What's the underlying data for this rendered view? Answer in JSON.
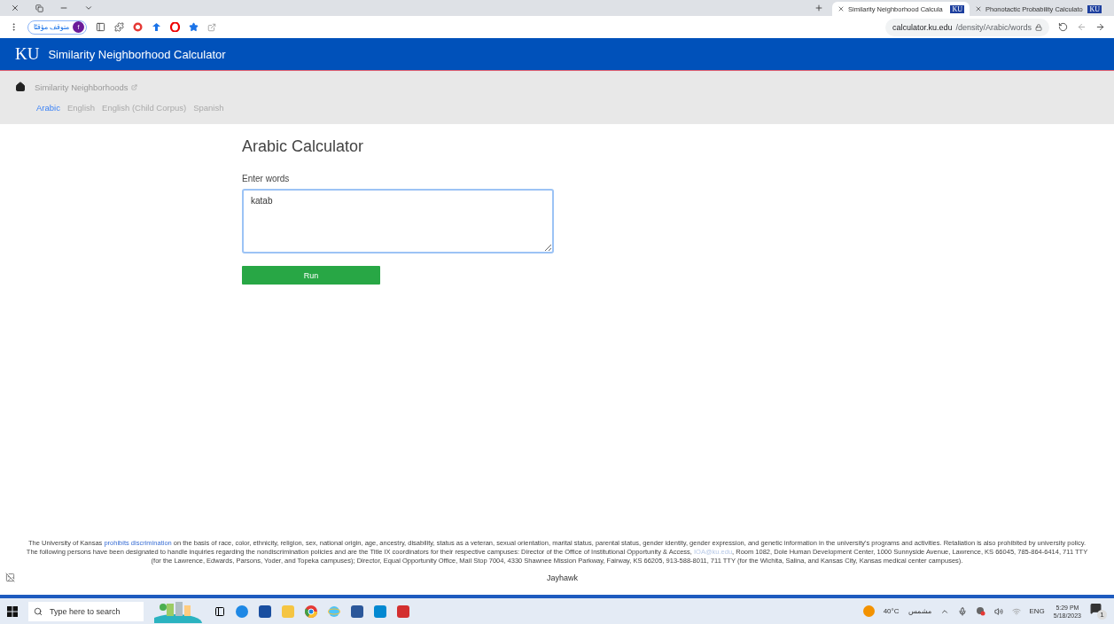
{
  "browser": {
    "tabs": [
      {
        "title": "Similarity Neighborhood Calcula",
        "favicon": "KU",
        "selected": true
      },
      {
        "title": "Phonotactic Probability Calculato",
        "favicon": "KU",
        "selected": false
      }
    ],
    "profile": {
      "initial": "f",
      "label": "متوقف مؤقتًا"
    },
    "address": {
      "host": "calculator.ku.edu",
      "path": "/density/Arabic/words"
    }
  },
  "site": {
    "logo": "KU",
    "title": "Similarity Neighborhood Calculator"
  },
  "breadcrumb": {
    "label": "Similarity Neighborhoods"
  },
  "languages": [
    {
      "label": "Arabic",
      "selected": true
    },
    {
      "label": "English",
      "selected": false
    },
    {
      "label": "English (Child Corpus)",
      "selected": false
    },
    {
      "label": "Spanish",
      "selected": false
    }
  ],
  "calculator": {
    "heading": "Arabic Calculator",
    "field_label": "Enter words",
    "value": "katab",
    "button": "Run"
  },
  "footer": {
    "before": "The University of Kansas ",
    "link": "prohibits discrimination",
    "middle": " on the basis of race, color, ethnicity, religion, sex, national origin, age, ancestry, disability, status as a veteran, sexual orientation, marital status, parental status, gender identity, gender expression, and genetic information in the university's programs and activities. Retaliation is also prohibited by university policy. The following persons have been designated to handle inquiries regarding the nondiscrimination policies and are the Title IX coordinators for their respective campuses: Director of the Office of Institutional Opportunity & Access, ",
    "email": "IOA@ku.edu",
    "after": ", Room 1082, Dole Human Development Center, 1000 Sunnyside Avenue, Lawrence, KS 66045, 785-864-6414, 711 TTY (for the Lawrence, Edwards, Parsons, Yoder, and Topeka campuses); Director, Equal Opportunity Office, Mail Stop 7004, 4330 Shawnee Mission Parkway, Fairway, KS 66205, 913-588-8011, 711 TTY (for the Wichita, Salina, and Kansas City, Kansas medical center campuses)."
  },
  "image_alt": "Jayhawk",
  "taskbar": {
    "search_placeholder": "Type here to search",
    "temperature": "40°C",
    "condition": "مشمس",
    "language": "ENG",
    "time": "5:29 PM",
    "date": "5/18/2023",
    "notifications": "1"
  }
}
